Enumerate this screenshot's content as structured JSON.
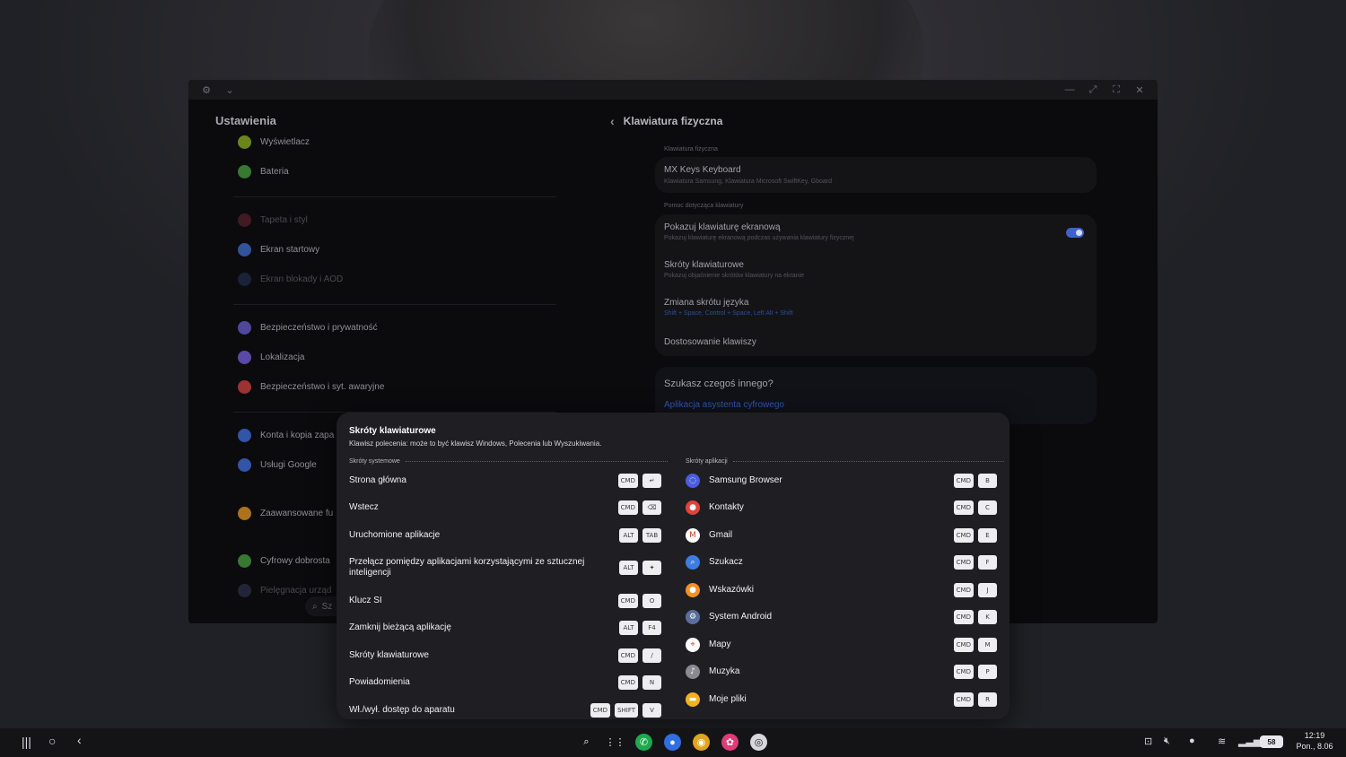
{
  "settings_window": {
    "title": "Ustawienia",
    "left_items": [
      {
        "label": "Wyświetlacz",
        "color": "#7b9c1f"
      },
      {
        "label": "Bateria",
        "color": "#3f8c3a"
      },
      {
        "label": "Tapeta i styl",
        "color": "#7a2a35",
        "dim": true
      },
      {
        "label": "Ekran startowy",
        "color": "#3a5fb3"
      },
      {
        "label": "Ekran blokady i AOD",
        "color": "#2a3a6a",
        "dim": true
      },
      {
        "label": "Bezpieczeństwo i prywatność",
        "color": "#5d52b5"
      },
      {
        "label": "Lokalizacja",
        "color": "#6a55c4"
      },
      {
        "label": "Bezpieczeństwo i syt. awaryjne",
        "color": "#b83a3a"
      },
      {
        "label": "Konta i kopia zapa",
        "color": "#3a63c6"
      },
      {
        "label": "Usługi Google",
        "color": "#3a63c6",
        "glyph": "G"
      },
      {
        "label": "Zaawansowane fu",
        "color": "#c9861f"
      },
      {
        "label": "Cyfrowy dobrosta",
        "color": "#3f8c3a"
      },
      {
        "label": "Pielęgnacja urząd",
        "color": "#3a3f66",
        "dim": true
      }
    ],
    "search_partial": "Sz",
    "right": {
      "back_glyph": "‹",
      "title": "Klawiatura fizyczna",
      "section1_label": "Klawiatura fizyczna",
      "keyboard_name": "MX Keys Keyboard",
      "keyboard_sub": "Klawiatura Samsung, Klawiatura Microsoft SwiftKey, Gboard",
      "section2_label": "Pomoc dotycząca klawiatury",
      "rows": [
        {
          "title": "Pokazuj klawiaturę ekranową",
          "sub": "Pokazuj klawiaturę ekranową podczas używania klawiatury fizycznej",
          "toggle": true
        },
        {
          "title": "Skróty klawiaturowe",
          "sub": "Pokazuj objaśnienie skrótów klawiatury na ekranie"
        },
        {
          "title": "Zmiana skrótu języka",
          "sub": "Shift + Space, Control + Space, Left Alt + Shift"
        },
        {
          "title": "Dostosowanie klawiszy",
          "sub": ""
        }
      ],
      "other_title": "Szukasz czegoś innego?",
      "other_link": "Aplikacja asystenta cyfrowego"
    }
  },
  "shortcut_dialog": {
    "title": "Skróty klawiaturowe",
    "subtitle": "Klawisz polecenia: może to być klawisz Windows, Polecenia lub Wyszukiwania.",
    "system_header": "Skróty systemowe",
    "apps_header": "Skróty aplikacji",
    "system": [
      {
        "label": "Strona główna",
        "keys": [
          "CMD",
          "↵"
        ]
      },
      {
        "label": "Wstecz",
        "keys": [
          "CMD",
          "⌫"
        ]
      },
      {
        "label": "Uruchomione aplikacje",
        "keys": [
          "ALT",
          "TAB"
        ]
      },
      {
        "label": "Przełącz pomiędzy aplikacjami korzystającymi ze sztucznej inteligencji",
        "keys": [
          "ALT",
          "✦"
        ]
      },
      {
        "label": "Klucz SI",
        "keys": [
          "CMD",
          "O"
        ]
      },
      {
        "label": "Zamknij bieżącą aplikację",
        "keys": [
          "ALT",
          "F4"
        ]
      },
      {
        "label": "Skróty klawiaturowe",
        "keys": [
          "CMD",
          "/"
        ]
      },
      {
        "label": "Powiadomienia",
        "keys": [
          "CMD",
          "N"
        ]
      },
      {
        "label": "Wł./wył. dostęp do aparatu",
        "keys": [
          "CMD",
          "SHIFT",
          "V"
        ]
      }
    ],
    "apps": [
      {
        "label": "Samsung Browser",
        "icon": "samsung-browser-icon",
        "color": "#4b5ce0",
        "glyph": "◌",
        "keys": [
          "CMD",
          "B"
        ]
      },
      {
        "label": "Kontakty",
        "icon": "contacts-icon",
        "color": "#e0433c",
        "glyph": "●",
        "keys": [
          "CMD",
          "C"
        ]
      },
      {
        "label": "Gmail",
        "icon": "gmail-icon",
        "color": "#ffffff",
        "glyph": "M",
        "keys": [
          "CMD",
          "E"
        ]
      },
      {
        "label": "Szukacz",
        "icon": "finder-icon",
        "color": "#3b7de0",
        "glyph": "⌕",
        "keys": [
          "CMD",
          "F"
        ]
      },
      {
        "label": "Wskazówki",
        "icon": "tips-icon",
        "color": "#f2911e",
        "glyph": "●",
        "keys": [
          "CMD",
          "J"
        ]
      },
      {
        "label": "System Android",
        "icon": "android-system-icon",
        "color": "#5b6f9e",
        "glyph": "⚙",
        "keys": [
          "CMD",
          "K"
        ]
      },
      {
        "label": "Mapy",
        "icon": "maps-icon",
        "color": "#ffffff",
        "glyph": "⌖",
        "keys": [
          "CMD",
          "M"
        ]
      },
      {
        "label": "Muzyka",
        "icon": "music-icon",
        "color": "#8a8a92",
        "glyph": "♪",
        "keys": [
          "CMD",
          "P"
        ]
      },
      {
        "label": "Moje pliki",
        "icon": "my-files-icon",
        "color": "#f2b21e",
        "glyph": "▬",
        "keys": [
          "CMD",
          "R"
        ]
      }
    ]
  },
  "taskbar": {
    "nav": [
      "|||",
      "○",
      "‹"
    ],
    "dock": [
      {
        "name": "search-icon",
        "glyph": "⌕",
        "color": "transparent"
      },
      {
        "name": "apps-grid-icon",
        "glyph": "⋮⋮",
        "color": "transparent"
      },
      {
        "name": "phone-app-icon",
        "glyph": "✆",
        "color": "#1fa84f"
      },
      {
        "name": "messages-app-icon",
        "glyph": "●",
        "color": "#2f6fe0"
      },
      {
        "name": "chrome-app-icon",
        "glyph": "◉",
        "color": "#e0a41e"
      },
      {
        "name": "gallery-app-icon",
        "glyph": "✿",
        "color": "#e03c78"
      },
      {
        "name": "camera-app-icon",
        "glyph": "◎",
        "color": "#d8d8dc"
      }
    ],
    "battery": "58",
    "time": "12:19",
    "date": "Pon., 8.06"
  }
}
